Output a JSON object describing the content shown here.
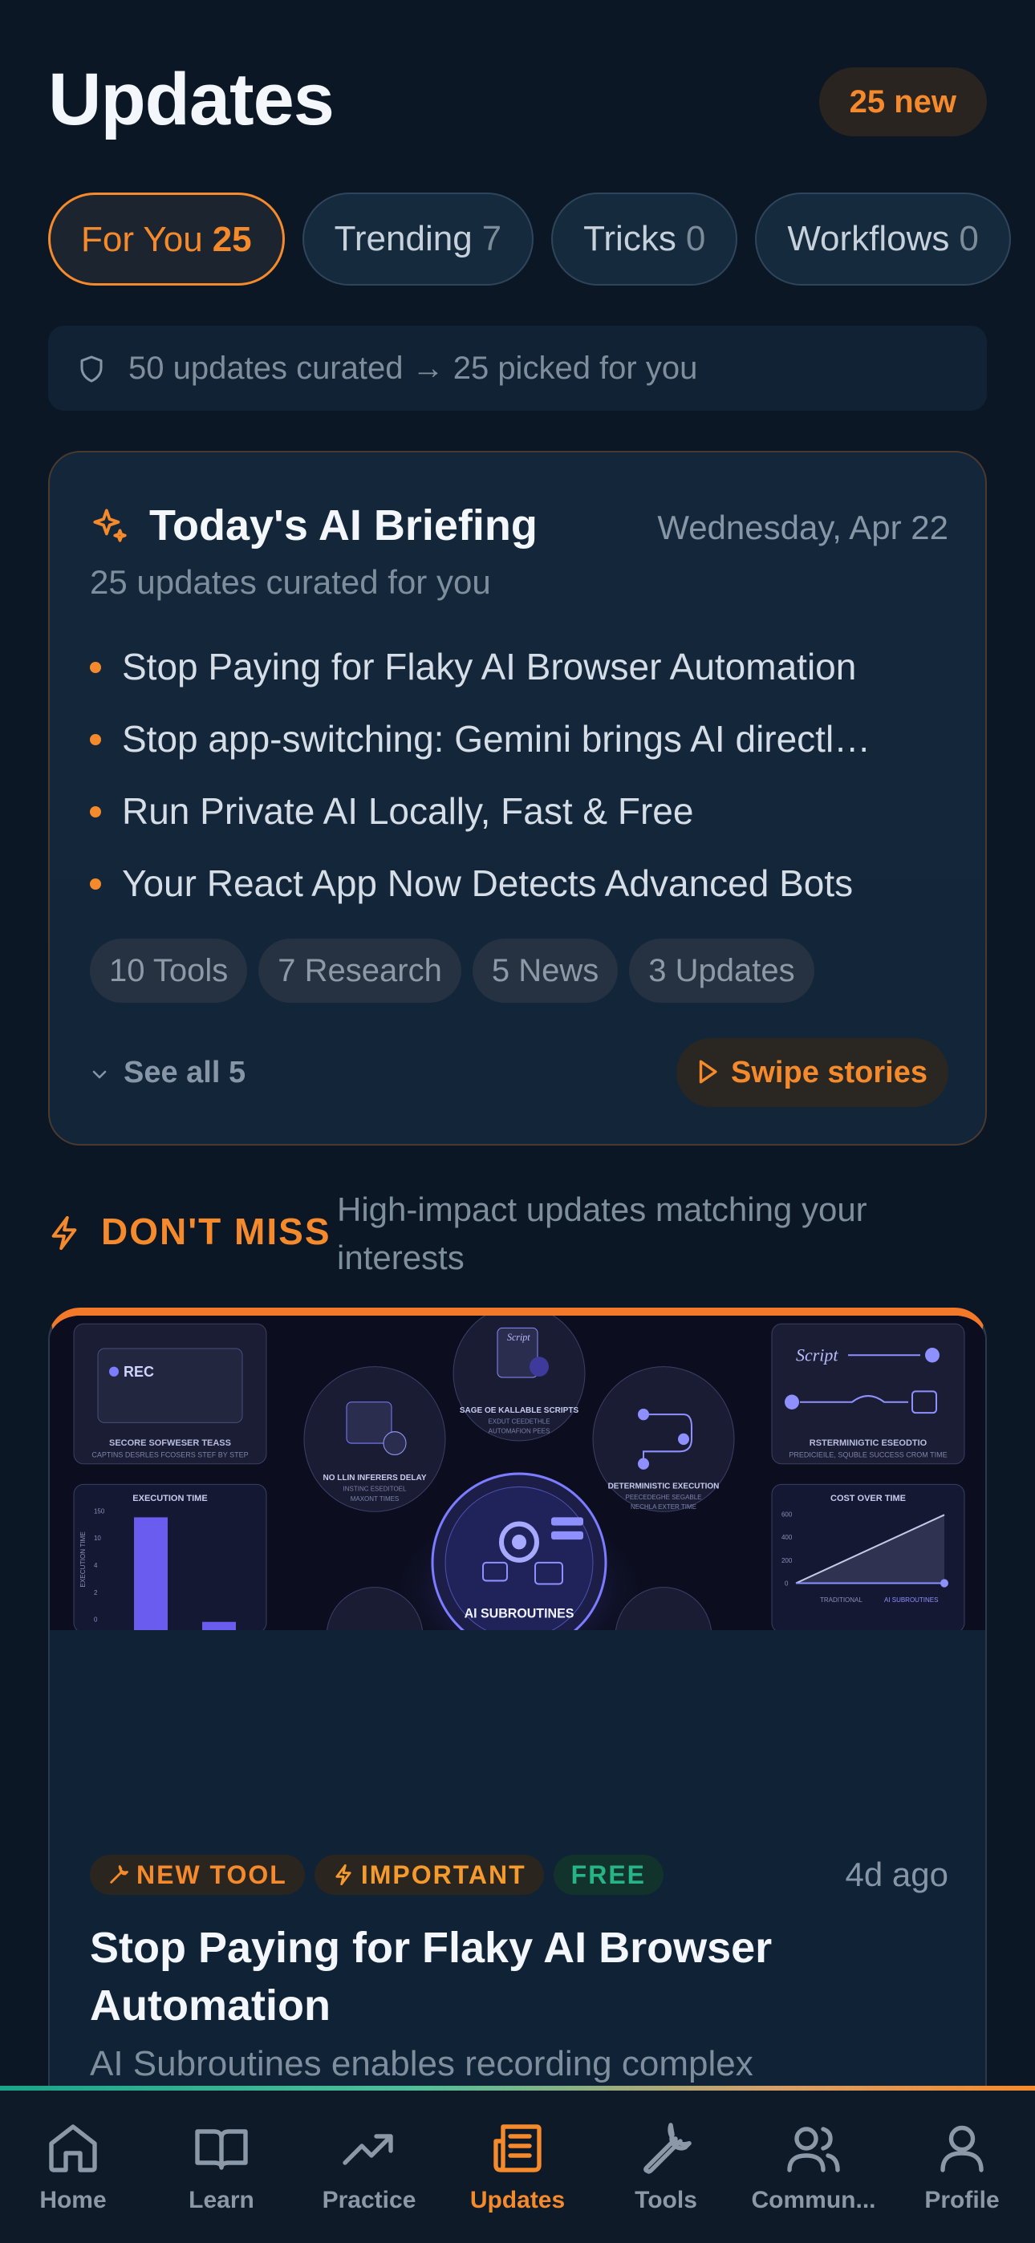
{
  "header": {
    "title": "Updates",
    "new_badge": "25 new"
  },
  "tabs": [
    {
      "label": "For You",
      "count": "25",
      "active": true
    },
    {
      "label": "Trending",
      "count": "7"
    },
    {
      "label": "Tricks",
      "count": "0"
    },
    {
      "label": "Workflows",
      "count": "0"
    }
  ],
  "info_strip": {
    "text": "50 updates curated → 25 picked for you",
    "icon": "shield-icon"
  },
  "briefing": {
    "title": "Today's AI Briefing",
    "date": "Wednesday, Apr 22",
    "subtitle": "25 updates curated for you",
    "items": [
      "Stop Paying for Flaky AI Browser Automation",
      "Stop app-switching: Gemini brings AI directl…",
      "Run Private AI Locally, Fast & Free",
      "Your React App Now Detects Advanced Bots"
    ],
    "chips": [
      "10 Tools",
      "7 Research",
      "5 News",
      "3 Updates"
    ],
    "see_all": "See all 5",
    "swipe": "Swipe stories"
  },
  "dont_miss": {
    "title": "DON'T MISS",
    "subtitle": "High-impact updates matching your interests"
  },
  "feature_card": {
    "tags": {
      "tool": "NEW TOOL",
      "important": "IMPORTANT",
      "free": "FREE"
    },
    "ago": "4d ago",
    "title": "Stop Paying for Flaky AI Browser Automation",
    "description": "AI Subroutines enables recording complex",
    "hero": {
      "rec": "REC",
      "center": "AI SUBROUTINES",
      "left_top_caption": "SECORE SOFWESER TEASS",
      "left_top_sub": "CAPTINS DESRLES FCOSERS STEF BY STEP",
      "mid_left": "NO LLIN INFERERS DELAY",
      "mid_left_sub": "INSTINC ESEDITOEL",
      "mid_left_sub2": "MAXONT TIMES",
      "top_center": "SAGE OE KALLABLE SCRIPTS",
      "top_center_sub": "EXDUT CEEDETHLE",
      "top_center_sub2": "AUTOMAFION PEES",
      "mid_right": "DETERMINISTIC EXECUTION",
      "mid_right_sub": "PEECEDEGHE SEGABLE",
      "mid_right_sub2": "NECHLA EXTER TIME",
      "right_top_caption": "RSTERMINIGTIC ESEODTIO",
      "right_top_sub": "PREDICIEILE, SQUBLE SUCCESS CROM TIME",
      "exec_time": "EXECUTION TIME",
      "exec_axis": "EXECUTION TIME",
      "cost": "COST OVER TIME",
      "script": "Script",
      "y_ticks_left": [
        "150",
        "10",
        "4",
        "2",
        "0"
      ],
      "y_ticks_right": [
        "600",
        "400",
        "200",
        "0"
      ],
      "legend": [
        "TRADITIONAL",
        "AI SUBROUTINES"
      ]
    }
  },
  "nav": [
    {
      "label": "Home",
      "icon": "home-icon"
    },
    {
      "label": "Learn",
      "icon": "book-icon"
    },
    {
      "label": "Practice",
      "icon": "trending-icon"
    },
    {
      "label": "Updates",
      "icon": "newspaper-icon",
      "active": true
    },
    {
      "label": "Tools",
      "icon": "wrench-icon"
    },
    {
      "label": "Commun...",
      "icon": "users-icon"
    },
    {
      "label": "Profile",
      "icon": "user-icon"
    }
  ],
  "colors": {
    "accent": "#f58a2c",
    "background": "#0b1725",
    "free": "#26b487"
  }
}
